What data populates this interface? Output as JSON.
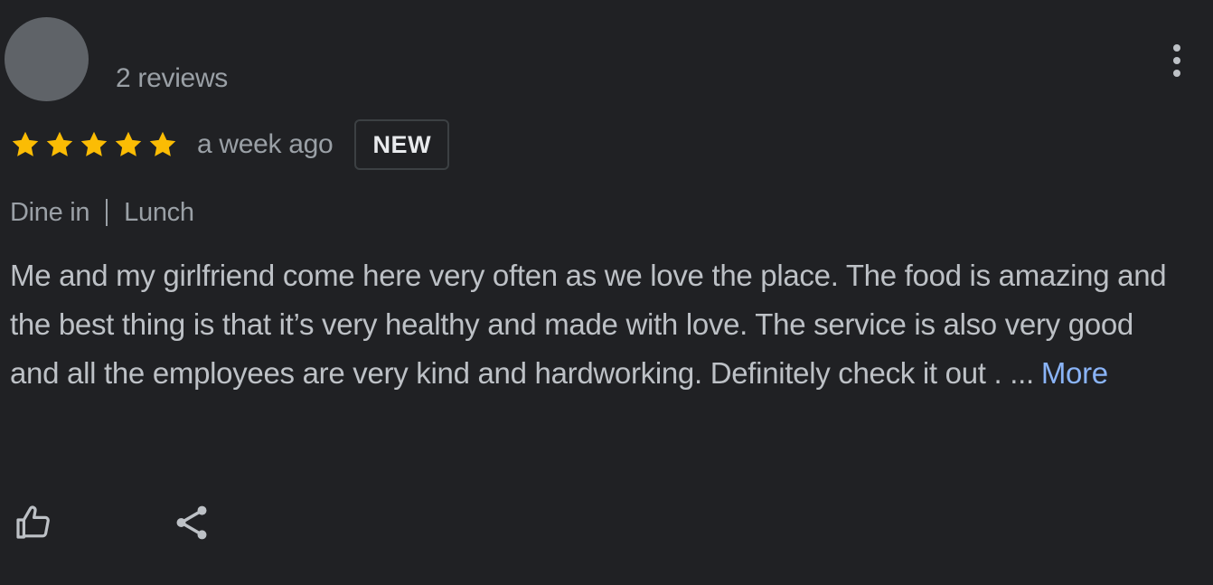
{
  "reviewer": {
    "avatar_color": "#5f6368",
    "meta": "2 reviews"
  },
  "menu": {
    "icon": "more-vert-icon"
  },
  "rating": {
    "stars": 5,
    "star_color": "#fbbc04",
    "time_ago": "a week ago",
    "badge": "NEW"
  },
  "tags": [
    "Dine in",
    "Lunch"
  ],
  "review": {
    "text": "Me and my girlfriend come here very often as we love the place. The food is amazing and the best thing is that it’s very healthy and made with love. The service is also very good and all the employees are very kind and hardworking. Definitely check it out . ...",
    "more_label": "More",
    "link_color": "#8ab4f8"
  },
  "actions": {
    "like_icon": "thumb-up-icon",
    "share_icon": "share-icon"
  }
}
